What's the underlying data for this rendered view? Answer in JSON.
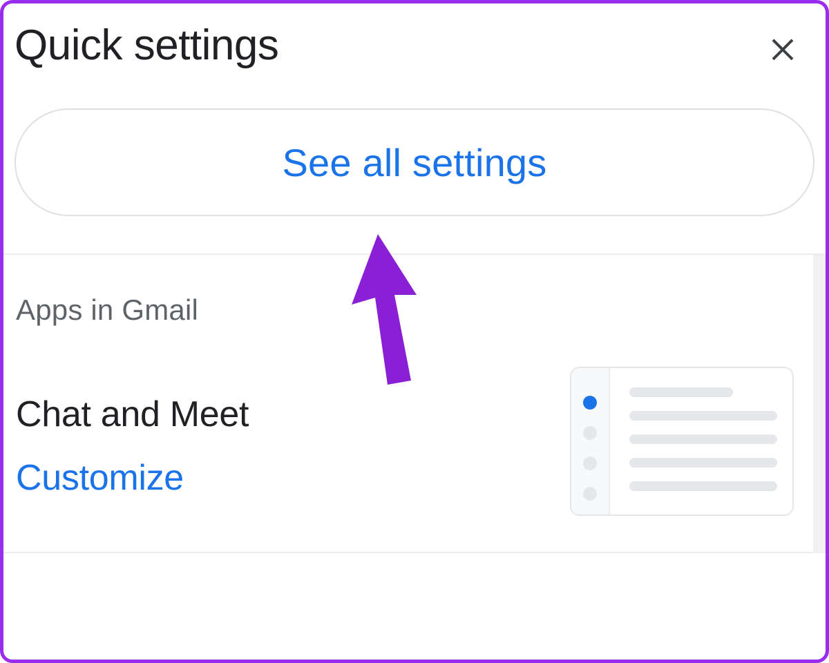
{
  "panel": {
    "title": "Quick settings",
    "close_icon": "close-icon",
    "see_all_label": "See all settings"
  },
  "apps": {
    "heading": "Apps in Gmail",
    "option_title": "Chat and Meet",
    "customize_label": "Customize"
  },
  "colors": {
    "accent": "#1a73e8",
    "annotation": "#8b1fd6"
  }
}
